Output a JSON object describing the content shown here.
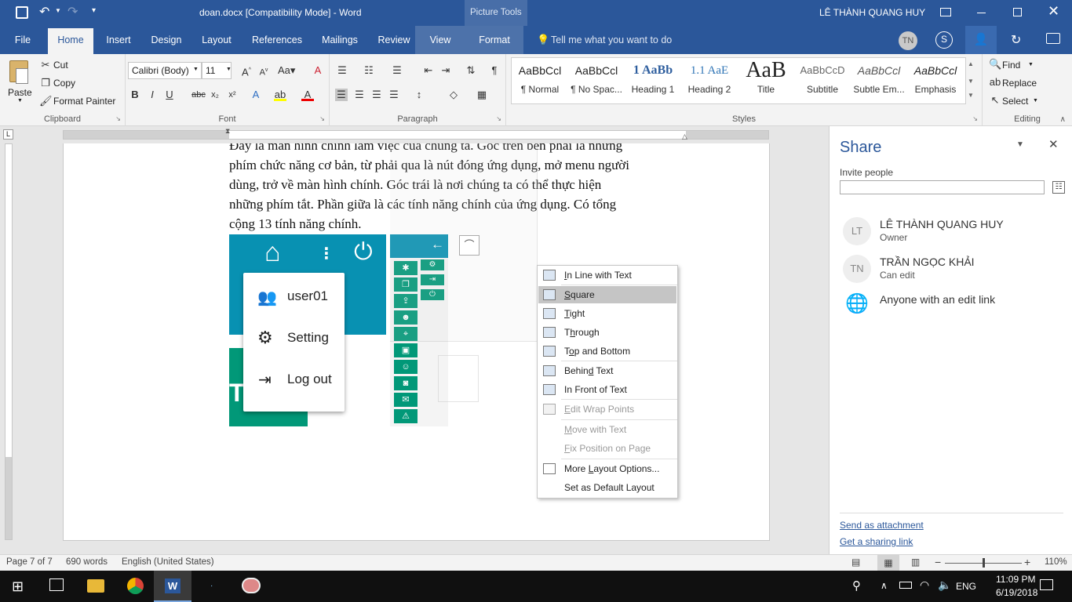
{
  "window": {
    "document_title": "doan.docx [Compatibility Mode]  -  Word",
    "context_tab_group": "Picture Tools",
    "user_name": "LÊ THÀNH QUANG HUY",
    "user_initials": "TN"
  },
  "tabs": [
    "File",
    "Home",
    "Insert",
    "Design",
    "Layout",
    "References",
    "Mailings",
    "Review",
    "View",
    "Format"
  ],
  "tell_me": "Tell me what you want to do",
  "clipboard": {
    "paste": "Paste",
    "cut": "Cut",
    "copy": "Copy",
    "format_painter": "Format Painter",
    "group": "Clipboard"
  },
  "font": {
    "name": "Calibri (Body)",
    "size": "11",
    "group": "Font"
  },
  "paragraph_group": "Paragraph",
  "styles": {
    "group": "Styles",
    "items": [
      {
        "preview": "AaBbCcl",
        "name": "¶ Normal"
      },
      {
        "preview": "AaBbCcl",
        "name": "¶ No Spac..."
      },
      {
        "preview": "1 AaBb",
        "name": "Heading 1"
      },
      {
        "preview": "1.1 AaE",
        "name": "Heading 2"
      },
      {
        "preview": "AaB",
        "name": "Title"
      },
      {
        "preview": "AaBbCcD",
        "name": "Subtitle"
      },
      {
        "preview": "AaBbCcl",
        "name": "Subtle Em..."
      },
      {
        "preview": "AaBbCcl",
        "name": "Emphasis"
      }
    ]
  },
  "editing": {
    "find": "Find",
    "replace": "Replace",
    "select": "Select",
    "group": "Editing"
  },
  "document": {
    "lines": [
      "Đây là màn hình chính làm việc của chúng ta. Góc trên bên phải là những",
      "phím chức năng cơ bản, từ phải qua là nút đóng ứng dụng, mở menu người",
      "dùng, trở về màn hình chính. Góc trái là nơi chúng ta có thể thực hiện",
      "những phím tắt. Phần giữa là các tính năng chính của ứng dụng. Có tổng",
      "cộng 13 tính năng chính."
    ],
    "image_menu": [
      "user01",
      "Setting",
      "Log out"
    ],
    "partial_text": "T"
  },
  "wrap_menu": {
    "items": [
      {
        "label": "In Line with Text",
        "ul": "I",
        "enabled": true
      },
      {
        "label": "Square",
        "ul": "S",
        "enabled": true
      },
      {
        "label": "Tight",
        "ul": "T",
        "enabled": true
      },
      {
        "label": "Through",
        "ul": "h",
        "enabled": true
      },
      {
        "label": "Top and Bottom",
        "ul": "o",
        "enabled": true
      },
      {
        "label": "Behind Text",
        "ul": "d",
        "enabled": true
      },
      {
        "label": "In Front of Text",
        "ul": "N",
        "enabled": true
      },
      {
        "label": "Edit Wrap Points",
        "ul": "E",
        "enabled": false
      },
      {
        "label": "Move with Text",
        "ul": "M",
        "enabled": false
      },
      {
        "label": "Fix Position on Page",
        "ul": "F",
        "enabled": false
      },
      {
        "label": "More Layout Options...",
        "ul": "L",
        "enabled": true
      },
      {
        "label": "Set as Default Layout",
        "ul": "A",
        "enabled": true
      }
    ]
  },
  "share": {
    "title": "Share",
    "invite_label": "Invite people",
    "people": [
      {
        "initials": "LT",
        "name": "LÊ THÀNH QUANG HUY",
        "role": "Owner"
      },
      {
        "initials": "TN",
        "name": "TRẦN NGỌC KHẢI",
        "role": "Can edit"
      }
    ],
    "anyone_link": "Anyone with an edit link",
    "send_attachment": "Send as attachment",
    "sharing_link": "Get a sharing link"
  },
  "status": {
    "page": "Page 7 of 7",
    "words": "690 words",
    "language": "English (United States)",
    "zoom": "110%"
  },
  "taskbar": {
    "lang": "ENG",
    "time": "11:09 PM",
    "date": "6/19/2018"
  },
  "colors": {
    "word_blue": "#2b579a",
    "teal": "#0891b2",
    "teal_green": "#019878"
  }
}
